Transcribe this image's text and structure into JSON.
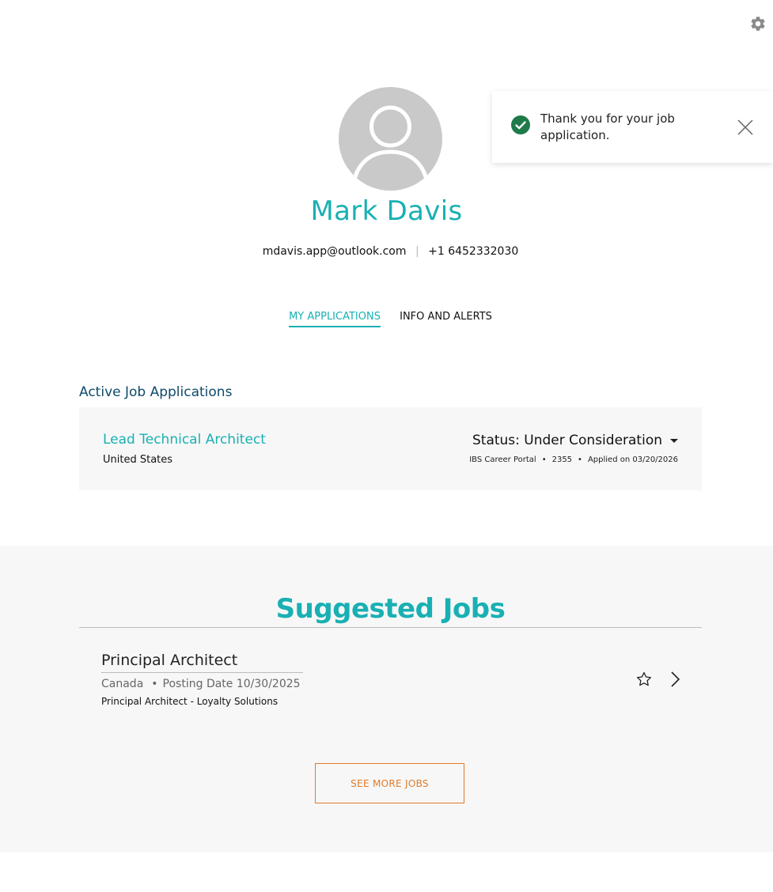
{
  "toast": {
    "message": "Thank you for your job application.",
    "icon": "check-circle-icon",
    "close_icon": "close-icon"
  },
  "settings_icon": "gear-icon",
  "profile": {
    "name": "Mark Davis",
    "email": "mdavis.app@outlook.com",
    "separator": "|",
    "phone": "+1 6452332030"
  },
  "tabs": [
    {
      "label": "MY APPLICATIONS",
      "active": true
    },
    {
      "label": "INFO AND ALERTS",
      "active": false
    }
  ],
  "active_applications": {
    "title": "Active Job Applications",
    "items": [
      {
        "job_title": "Lead Technical Architect",
        "location": "United States",
        "status": "Status: Under Consideration",
        "source": "IBS Career Portal",
        "job_id": "2355",
        "applied": "Applied on 03/20/2026"
      }
    ]
  },
  "suggested": {
    "heading": "Suggested Jobs",
    "jobs": [
      {
        "title": "Principal Architect",
        "location": "Canada",
        "posting_date": "Posting Date 10/30/2025",
        "description": "Principal Architect - Loyalty Solutions"
      }
    ],
    "see_more_label": "SEE MORE JOBS"
  },
  "colors": {
    "accent": "#19b0b3",
    "section_title": "#0e4a6a",
    "cta": "#e07b2a",
    "success": "#1f7a4a"
  }
}
